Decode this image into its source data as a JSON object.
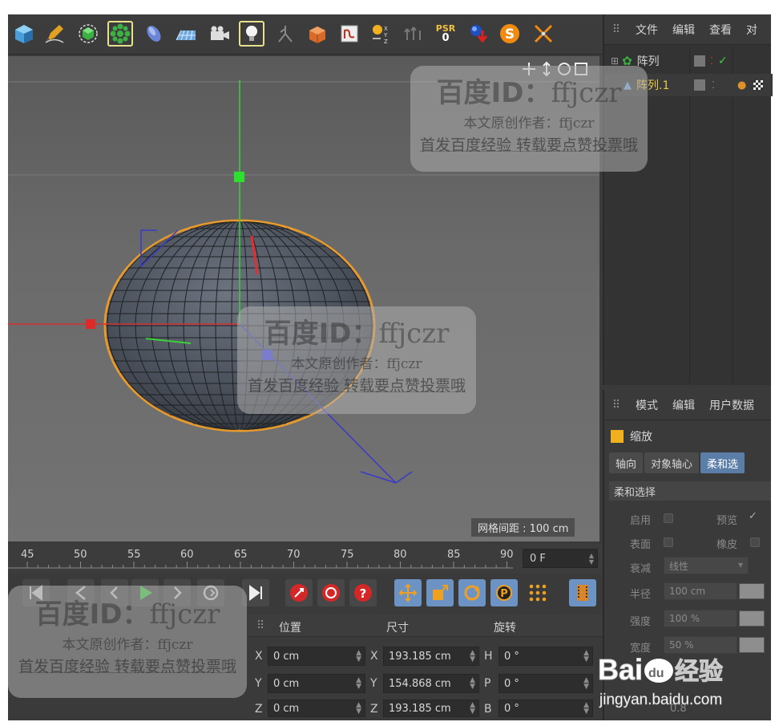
{
  "toolbar": {
    "icons": [
      "cube-icon",
      "pen-icon",
      "cube-select-icon",
      "array-icon",
      "deformer-icon",
      "floor-icon",
      "camera-icon",
      "light-icon",
      "character-icon",
      "box-arrow-icon",
      "spline-tag-icon",
      "xyz-coords-icon",
      "snap-icon",
      "psr-icon",
      "render-icon",
      "s-icon",
      "align-icon"
    ],
    "psr_label": "PSR",
    "psr_value": "0"
  },
  "viewport": {
    "grid_spacing": "网格间距 : 100 cm"
  },
  "objects_panel": {
    "menu": [
      "文件",
      "编辑",
      "查看",
      "对"
    ],
    "rows": [
      {
        "name": "阵列",
        "active": false
      },
      {
        "name": "阵列.1",
        "active": true
      }
    ]
  },
  "attributes_panel": {
    "menu": [
      "模式",
      "编辑",
      "用户数据"
    ],
    "title": "缩放",
    "tabs": [
      {
        "label": "轴向",
        "active": false
      },
      {
        "label": "对象轴心",
        "active": false
      },
      {
        "label": "柔和选",
        "active": true
      }
    ],
    "section": "柔和选择",
    "fields": {
      "enable": "启用",
      "preview": "预览",
      "surface": "表面",
      "rubber": "橡皮",
      "falloff": "衰减",
      "falloff_value": "线性",
      "radius": "半径",
      "radius_value": "100 cm",
      "strength": "强度",
      "strength_value": "100 %",
      "width": "宽度",
      "width_value": "50 %",
      "bottom_value": "0.8"
    }
  },
  "timeline": {
    "ticks": [
      "45",
      "50",
      "55",
      "60",
      "65",
      "70",
      "75",
      "80",
      "85",
      "90"
    ],
    "current_frame": "0 F"
  },
  "coordinates": {
    "headers": [
      "位置",
      "尺寸",
      "旋转"
    ],
    "rows": [
      {
        "axis": "X",
        "position": "0 cm",
        "size_axis": "X",
        "size": "193.185 cm",
        "rot_axis": "H",
        "rotation": "0 °"
      },
      {
        "axis": "Y",
        "position": "0 cm",
        "size_axis": "Y",
        "size": "154.868 cm",
        "rot_axis": "P",
        "rotation": "0 °"
      },
      {
        "axis": "Z",
        "position": "0 cm",
        "size_axis": "Z",
        "size": "193.185 cm",
        "rot_axis": "B",
        "rotation": "0 °"
      }
    ]
  },
  "watermarks": {
    "line1_prefix": "百度ID：",
    "line1_user": "ffjczr",
    "line2": "本文原创作者：ffjczr",
    "line3": "首发百度经验 转载要点赞投票哦"
  },
  "baidu_logo": {
    "brand": "Bai",
    "brand_suffix": "du",
    "product": "经验",
    "url": "jingyan.baidu.com"
  },
  "colors": {
    "accent_blue": "#6c93c4",
    "active_object": "#e8c840",
    "selection_outline": "#e69a2e"
  }
}
